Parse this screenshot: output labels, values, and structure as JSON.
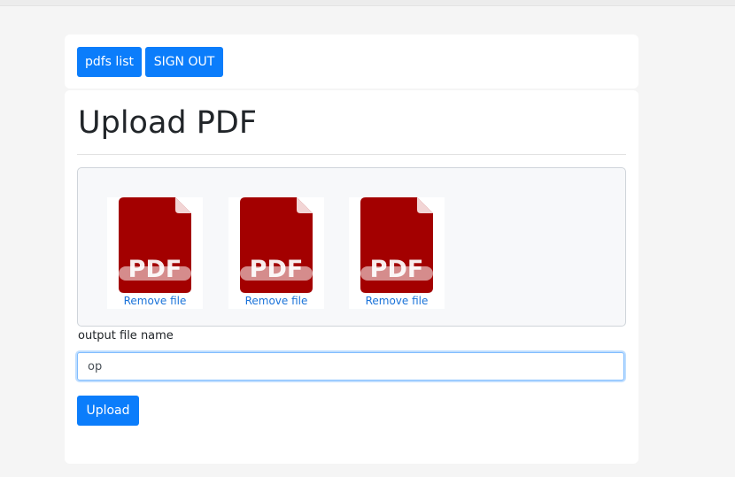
{
  "nav": {
    "pdfs_list_label": "pdfs list",
    "sign_out_label": "SIGN OUT"
  },
  "main": {
    "title": "Upload PDF",
    "files": [
      {
        "icon": "pdf-file-icon",
        "remove_label": "Remove file"
      },
      {
        "icon": "pdf-file-icon",
        "remove_label": "Remove file"
      },
      {
        "icon": "pdf-file-icon",
        "remove_label": "Remove file"
      }
    ],
    "output_label": "output file name",
    "output_value": "op",
    "upload_label": "Upload"
  },
  "colors": {
    "primary": "#0b7dfb",
    "pdf_red": "#a30000",
    "link": "#1a73d9"
  }
}
